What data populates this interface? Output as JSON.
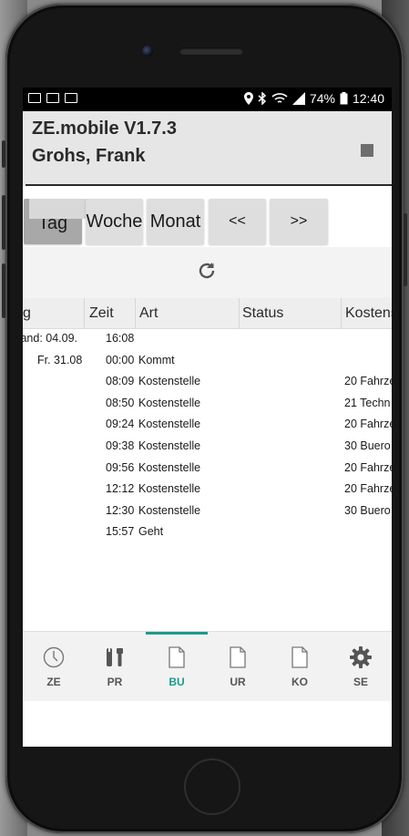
{
  "statusbar": {
    "battery": "74%",
    "time": "12:40"
  },
  "app": {
    "title": "ZE.mobile V1.7.3",
    "user": "Grohs, Frank"
  },
  "nav": {
    "tag": "Tag",
    "woche": "Woche",
    "monat": "Monat",
    "prev": "<<",
    "next": ">>"
  },
  "table": {
    "headers": [
      "g",
      "Zeit",
      "Art",
      "Status",
      "Kostens"
    ],
    "rows": [
      {
        "date": "tand: 04.09.",
        "zeit": "16:08",
        "art": "",
        "kosten": ""
      },
      {
        "date": "Fr. 31.08",
        "zeit": "00:00",
        "art": "Kommt",
        "kosten": ""
      },
      {
        "date": "",
        "zeit": "08:09",
        "art": "Kostenstelle",
        "kosten": "20 Fahrze"
      },
      {
        "date": "",
        "zeit": "08:50",
        "art": "Kostenstelle",
        "kosten": "21 Techn"
      },
      {
        "date": "",
        "zeit": "09:24",
        "art": "Kostenstelle",
        "kosten": "20 Fahrze"
      },
      {
        "date": "",
        "zeit": "09:38",
        "art": "Kostenstelle",
        "kosten": "30 Buero"
      },
      {
        "date": "",
        "zeit": "09:56",
        "art": "Kostenstelle",
        "kosten": "20 Fahrze"
      },
      {
        "date": "",
        "zeit": "12:12",
        "art": "Kostenstelle",
        "kosten": "20 Fahrze"
      },
      {
        "date": "",
        "zeit": "12:30",
        "art": "Kostenstelle",
        "kosten": "30 Buero"
      },
      {
        "date": "",
        "zeit": "15:57",
        "art": "Geht",
        "kosten": ""
      }
    ]
  },
  "tabs": [
    {
      "label": "ZE",
      "icon": "clock-icon"
    },
    {
      "label": "PR",
      "icon": "tools-icon"
    },
    {
      "label": "BU",
      "icon": "document-icon"
    },
    {
      "label": "UR",
      "icon": "document-icon"
    },
    {
      "label": "KO",
      "icon": "document-icon"
    },
    {
      "label": "SE",
      "icon": "gear-icon"
    }
  ],
  "colors": {
    "accent": "#1a9a8e",
    "header_bg": "#e6e6e6",
    "active_button": "#a8a8a8"
  }
}
